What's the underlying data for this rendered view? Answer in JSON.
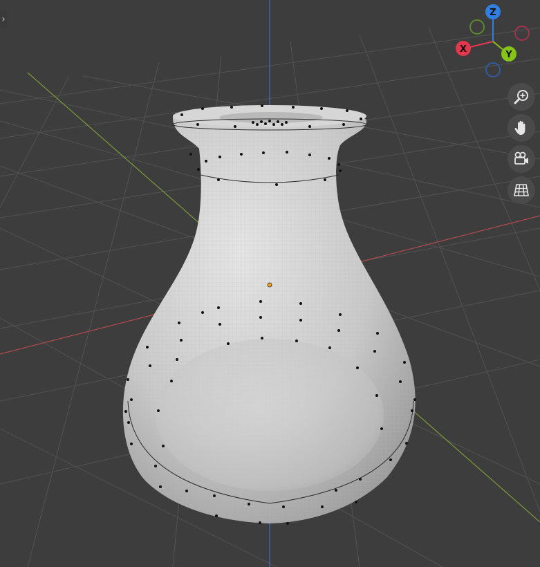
{
  "viewport": {
    "background": "#3d3d3d",
    "grid_color": "#555555",
    "x_axis_color": "#b24a4f",
    "y_axis_color": "#7c9b3a",
    "z_axis_color": "#3f6fc2",
    "mesh_color": "#cfcfcf"
  },
  "navigation_gizmo": {
    "z_label": "Z",
    "x_label": "X",
    "y_label": "Y",
    "z_color": "#2f7fe0",
    "x_color": "#e2384e",
    "y_color": "#86c418"
  },
  "view_controls": {
    "zoom": "zoom-icon",
    "pan": "hand-icon",
    "camera": "camera-icon",
    "perspective": "grid-icon"
  },
  "sidebar_toggle_icon": "chevron-right-icon"
}
